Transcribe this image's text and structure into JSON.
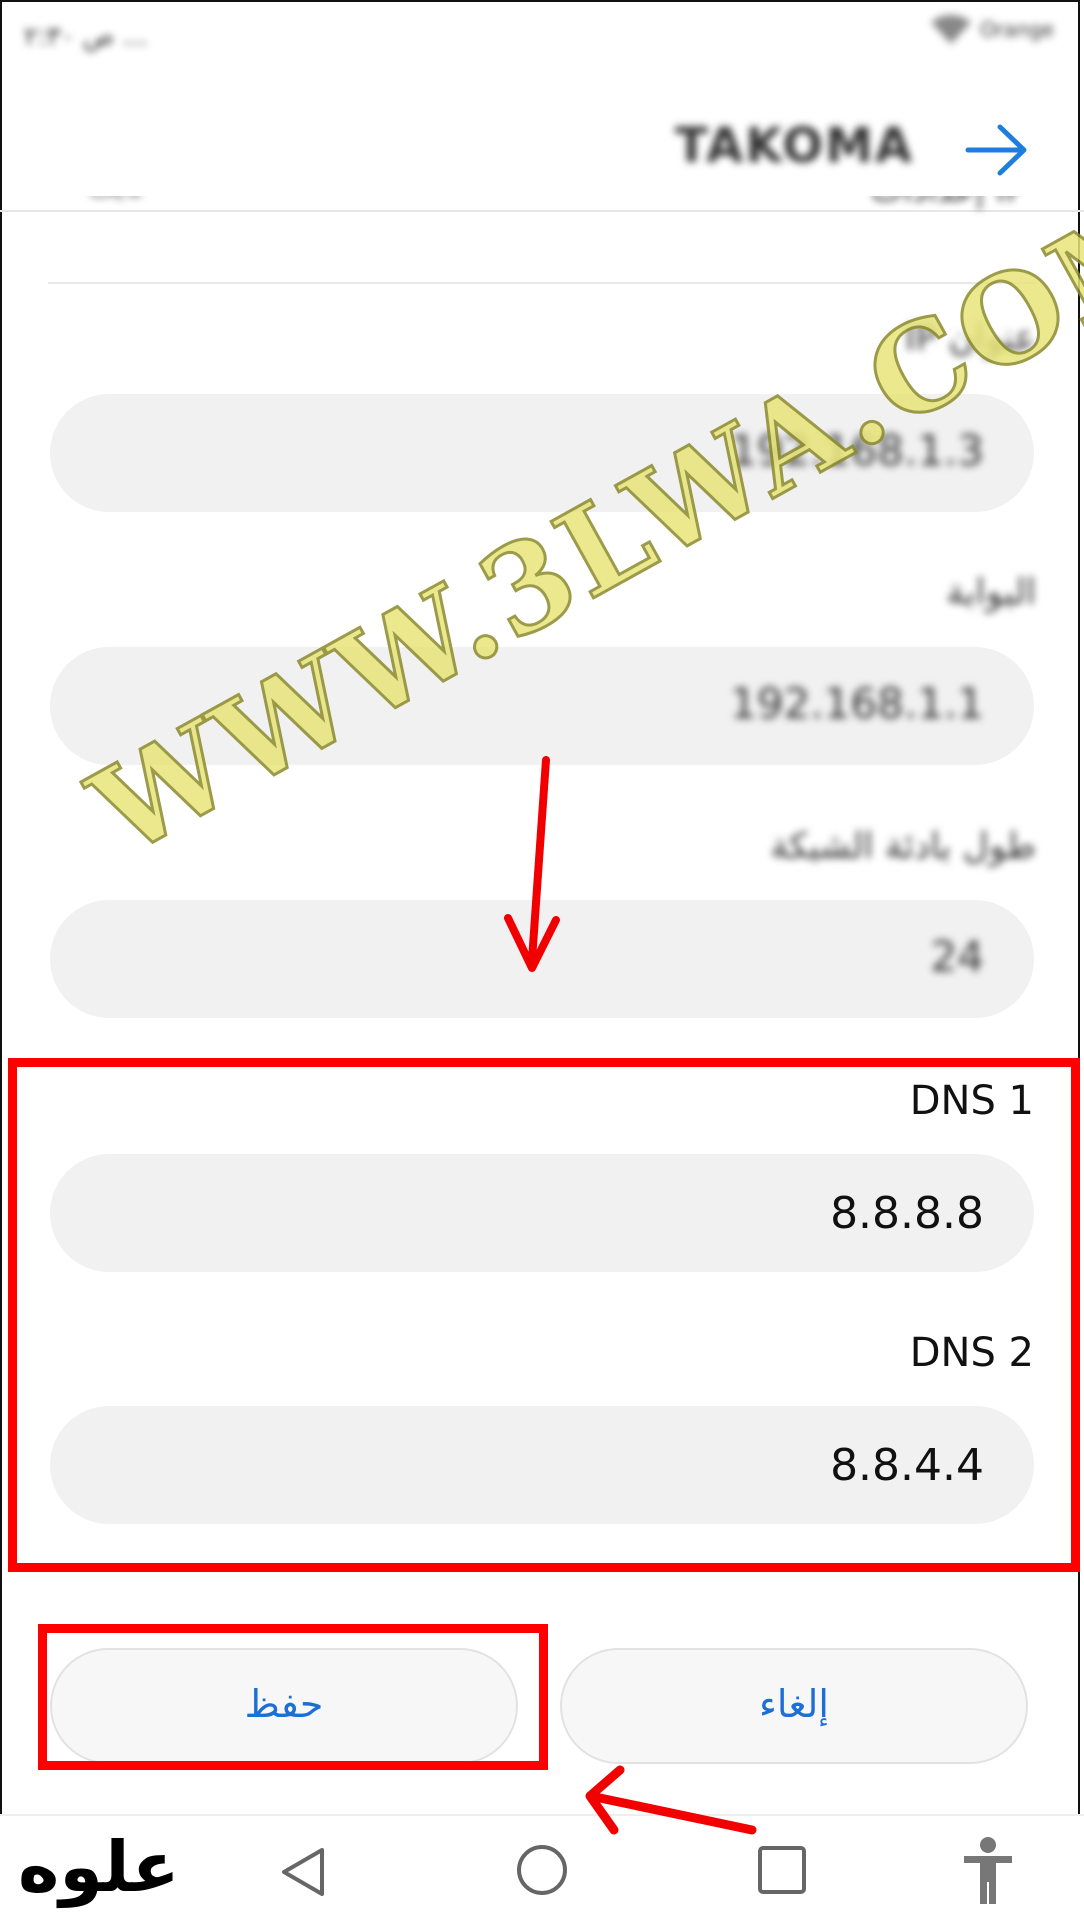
{
  "status_bar": {
    "left_text": "ص ٢:٣٠ ...",
    "carrier": "Orange"
  },
  "topbar": {
    "network_name": "TAKOMA",
    "forward_icon": "arrow-right-icon"
  },
  "ip_settings": {
    "label": "إعدادات IP",
    "value": "ثابت"
  },
  "fields": {
    "ip": {
      "label": "عنوان IP",
      "value": "192.168.1.3"
    },
    "gateway": {
      "label": "البوابة",
      "value": "192.168.1.1"
    },
    "prefix": {
      "label": "طول بادئة الشبكة",
      "value": "24"
    },
    "dns1": {
      "label": "DNS 1",
      "value": "8.8.8.8"
    },
    "dns2": {
      "label": "DNS 2",
      "value": "8.8.4.4"
    }
  },
  "buttons": {
    "save": "حفظ",
    "cancel": "إلغاء"
  },
  "navbar": {
    "icons": [
      "back-triangle-icon",
      "home-circle-icon",
      "recents-square-icon",
      "accessibility-icon"
    ]
  },
  "overlay": {
    "watermark": "WWW.3LWA.COM",
    "brand": "علوه"
  },
  "colors": {
    "highlight": "#ff0000",
    "button_text": "#1d6fd6",
    "field_bg": "#f1f1f1"
  }
}
